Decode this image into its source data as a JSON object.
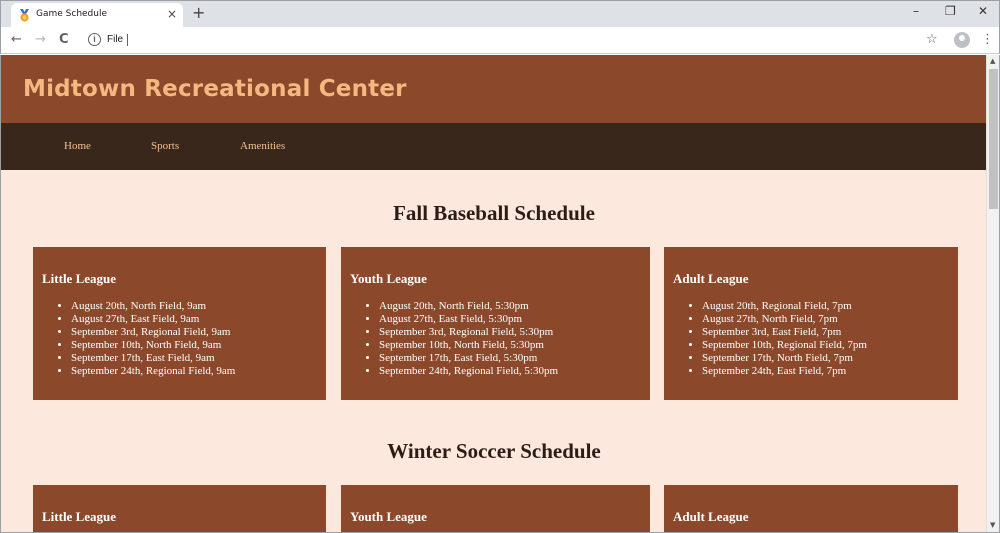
{
  "browser": {
    "tab_title": "Game Schedule",
    "tab_close": "×",
    "new_tab": "+",
    "url_scheme": "File",
    "window_controls": {
      "minimize": "–",
      "restore": "❐",
      "close": "✕"
    },
    "nav_icons": {
      "back": "←",
      "forward": "→",
      "reload": "C"
    },
    "star": "☆",
    "menu": "⋮"
  },
  "site": {
    "title": "Midtown Recreational Center",
    "nav": [
      "Home",
      "Sports",
      "Amenities"
    ]
  },
  "sections": [
    {
      "title": "Fall Baseball Schedule",
      "cards": [
        {
          "title": "Little League",
          "items": [
            "August 20th, North Field, 9am",
            "August 27th, East Field, 9am",
            "September 3rd, Regional Field, 9am",
            "September 10th, North Field, 9am",
            "September 17th, East Field, 9am",
            "September 24th, Regional Field, 9am"
          ]
        },
        {
          "title": "Youth League",
          "items": [
            "August 20th, North Field, 5:30pm",
            "August 27th, East Field, 5:30pm",
            "September 3rd, Regional Field, 5:30pm",
            "September 10th, North Field, 5:30pm",
            "September 17th, East Field, 5:30pm",
            "September 24th, Regional Field, 5:30pm"
          ]
        },
        {
          "title": "Adult League",
          "items": [
            "August 20th, Regional Field, 7pm",
            "August 27th, North Field, 7pm",
            "September 3rd, East Field, 7pm",
            "September 10th, Regional Field, 7pm",
            "September 17th, North Field, 7pm",
            "September 24th, East Field, 7pm"
          ]
        }
      ]
    },
    {
      "title": "Winter Soccer Schedule",
      "cards": [
        {
          "title": "Little League"
        },
        {
          "title": "Youth League"
        },
        {
          "title": "Adult League"
        }
      ]
    }
  ],
  "colors": {
    "header": "#8c482b",
    "nav": "#3a271b",
    "page_bg": "#fce8dc",
    "title_text": "#f5b880",
    "card_bg": "#8c482b"
  }
}
